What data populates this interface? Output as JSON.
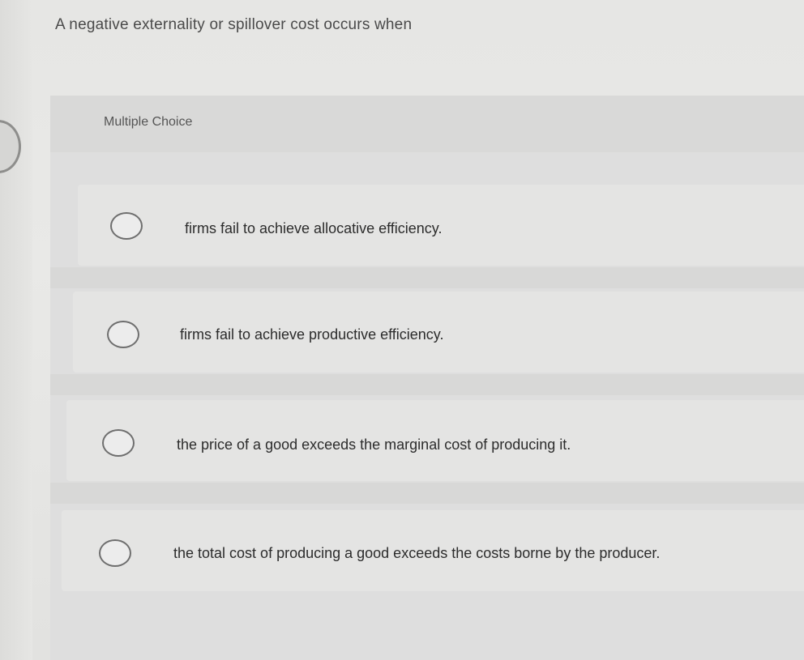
{
  "question": {
    "text": "A negative externality or spillover cost occurs when"
  },
  "multiple_choice": {
    "label": "Multiple Choice",
    "options": [
      {
        "text": "firms fail to achieve allocative efficiency."
      },
      {
        "text": "firms fail to achieve productive efficiency."
      },
      {
        "text": "the price of a good exceeds the marginal cost of producing it."
      },
      {
        "text": "the total cost of producing a good exceeds the costs borne by the producer."
      }
    ]
  }
}
